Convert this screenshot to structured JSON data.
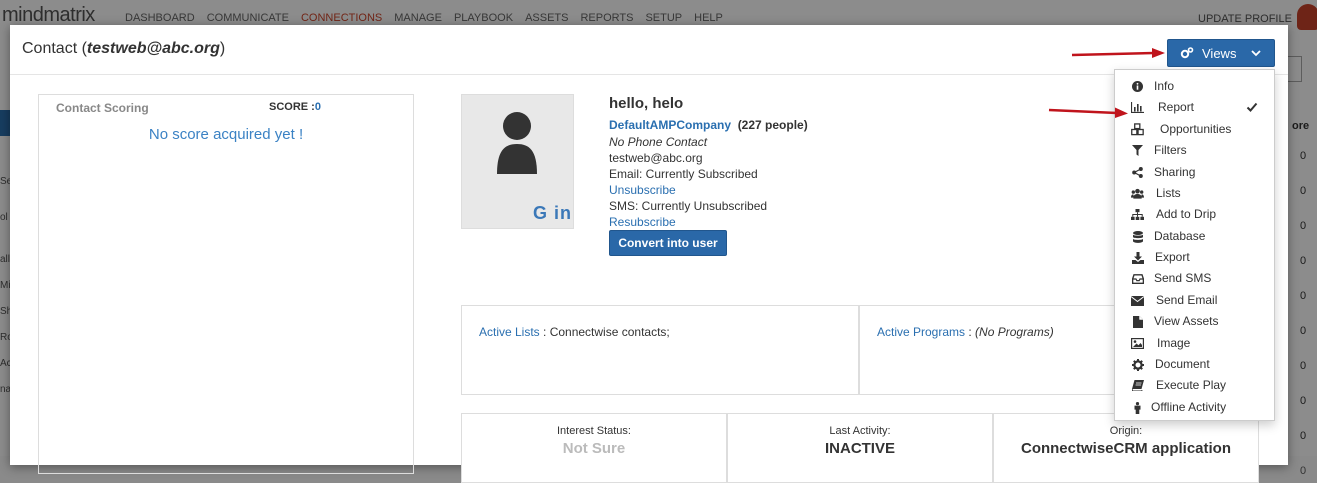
{
  "background": {
    "logo": "mindmatrix",
    "nav": [
      "DASHBOARD",
      "COMMUNICATE",
      "CONNECTIONS",
      "MANAGE",
      "PLAYBOOK",
      "ASSETS",
      "REPORTS",
      "SETUP",
      "HELP"
    ],
    "active_nav": "CONNECTIONS",
    "profile_link": "UPDATE PROFILE",
    "side_fragments": [
      "Se",
      "ol",
      "all",
      "Mi",
      "Sh",
      "Ro",
      "Ac",
      "na"
    ],
    "right_header": "ore",
    "right_values": [
      "0",
      "0",
      "0",
      "0",
      "0",
      "0",
      "0",
      "0",
      "0",
      "0"
    ]
  },
  "modal": {
    "title_prefix": "Contact (",
    "title_email": "testweb@abc.org",
    "title_suffix": ")",
    "views_label": "Views"
  },
  "scoring": {
    "label": "Contact Scoring",
    "score_label": "SCORE :",
    "score_value": "0",
    "empty_text": "No score acquired yet !"
  },
  "contact": {
    "social": "G in",
    "name": "hello, helo",
    "company": "DefaultAMPCompany",
    "company_count": "(227 people)",
    "phone": "No Phone Contact",
    "email": "testweb@abc.org",
    "email_status": "Email: Currently Subscribed",
    "unsubscribe": "Unsubscribe",
    "sms_status": "SMS: Currently Unsubscribed",
    "resubscribe": "Resubscribe",
    "convert_label": "Convert into user"
  },
  "lists": {
    "active_lists_label": "Active Lists",
    "active_lists_value": " : Connectwise contacts;",
    "active_programs_label": "Active Programs",
    "active_programs_value": "(No Programs)"
  },
  "stats": [
    {
      "key": "Interest Status:",
      "value": "Not Sure"
    },
    {
      "key": "Last Activity:",
      "value": "INACTIVE"
    },
    {
      "key": "Origin:",
      "value": "ConnectwiseCRM application"
    }
  ],
  "views_menu": [
    {
      "label": "Info",
      "icon": "info-icon"
    },
    {
      "label": "Report",
      "icon": "bar-chart-icon",
      "checked": true
    },
    {
      "label": "Opportunities",
      "icon": "cubes-icon"
    },
    {
      "label": "Filters",
      "icon": "filter-icon"
    },
    {
      "label": "Sharing",
      "icon": "share-icon"
    },
    {
      "label": "Lists",
      "icon": "users-icon"
    },
    {
      "label": "Add to Drip",
      "icon": "sitemap-icon"
    },
    {
      "label": "Database",
      "icon": "database-icon"
    },
    {
      "label": "Export",
      "icon": "download-icon"
    },
    {
      "label": "Send SMS",
      "icon": "inbox-icon"
    },
    {
      "label": "Send Email",
      "icon": "envelope-icon"
    },
    {
      "label": "View Assets",
      "icon": "file-icon"
    },
    {
      "label": "Image",
      "icon": "image-icon"
    },
    {
      "label": "Document",
      "icon": "cog-icon"
    },
    {
      "label": "Execute Play",
      "icon": "book-icon"
    },
    {
      "label": "Offline Activity",
      "icon": "person-icon"
    }
  ],
  "colors": {
    "primary": "#2a68a8",
    "link": "#2a6fb0",
    "active_nav": "#d0452b",
    "annotation_arrow": "#c0141c"
  }
}
